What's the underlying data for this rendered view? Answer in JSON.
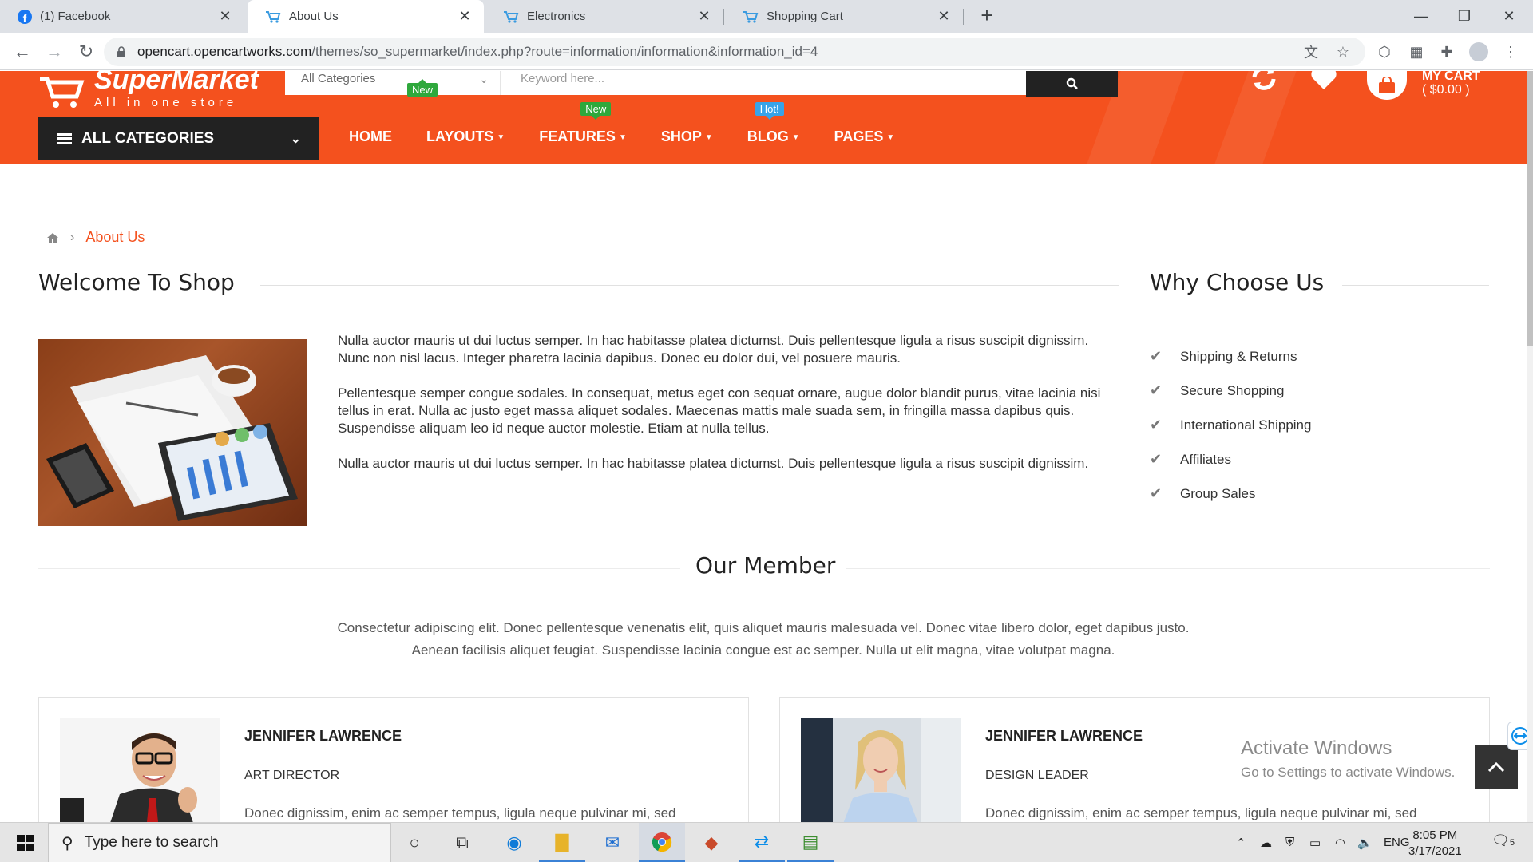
{
  "browser": {
    "tabs": [
      {
        "title": "(1) Facebook",
        "icon": "facebook-icon",
        "active": false
      },
      {
        "title": "About Us",
        "icon": "cart-favicon",
        "active": true
      },
      {
        "title": "Electronics",
        "icon": "cart-favicon",
        "active": false
      },
      {
        "title": "Shopping Cart",
        "icon": "cart-favicon",
        "active": false
      }
    ],
    "url_host": "opencart.opencartworks.com",
    "url_path": "/themes/so_supermarket/index.php?route=information/information&information_id=4"
  },
  "header": {
    "logo_name": "SuperMarket",
    "tagline": "All in one store",
    "category_select": "All Categories",
    "search_placeholder": "Keyword here...",
    "cart_label": "MY CART",
    "cart_total": "( $0.00 )",
    "all_categories_label": "ALL CATEGORIES",
    "nav": [
      {
        "label": "HOME"
      },
      {
        "label": "LAYOUTS"
      },
      {
        "label": "FEATURES"
      },
      {
        "label": "SHOP"
      },
      {
        "label": "BLOG"
      },
      {
        "label": "PAGES"
      }
    ],
    "badges": {
      "features": "New",
      "blog": "Hot!",
      "home": "New"
    },
    "accent_color": "#f4511e"
  },
  "breadcrumb": {
    "current": "About Us"
  },
  "welcome": {
    "heading": "Welcome To Shop",
    "paragraphs": [
      "Nulla auctor mauris ut dui luctus semper. In hac habitasse platea dictumst. Duis pellentesque ligula a risus suscipit dignissim. Nunc non nisl lacus. Integer pharetra lacinia dapibus. Donec eu dolor dui, vel posuere mauris.",
      "Pellentesque semper congue sodales. In consequat, metus eget con sequat ornare, augue dolor blandit purus, vitae lacinia nisi tellus in erat. Nulla ac justo eget massa aliquet sodales. Maecenas mattis male suada sem, in fringilla massa dapibus quis. Suspendisse aliquam leo id neque auctor molestie. Etiam at nulla tellus.",
      "Nulla auctor mauris ut dui luctus semper. In hac habitasse platea dictumst. Duis pellentesque ligula a risus suscipit dignissim."
    ]
  },
  "why": {
    "heading": "Why Choose Us",
    "items": [
      "Shipping & Returns",
      "Secure Shopping",
      "International Shipping",
      "Affiliates",
      "Group Sales"
    ]
  },
  "members": {
    "heading": "Our Member",
    "intro_line1": "Consectetur adipiscing elit. Donec pellentesque venenatis elit, quis aliquet mauris malesuada vel. Donec vitae libero dolor, eget dapibus justo.",
    "intro_line2": "Aenean facilisis aliquet feugiat. Suspendisse lacinia congue est ac semper. Nulla ut elit magna, vitae volutpat magna.",
    "cards": [
      {
        "name": "JENNIFER LAWRENCE",
        "role": "ART DIRECTOR",
        "bio": "Donec dignissim, enim ac semper tempus, ligula neque pulvinar mi, sed"
      },
      {
        "name": "JENNIFER LAWRENCE",
        "role": "DESIGN LEADER",
        "bio": "Donec dignissim, enim ac semper tempus, ligula neque pulvinar mi, sed"
      }
    ]
  },
  "watermark": {
    "line1": "Activate Windows",
    "line2": "Go to Settings to activate Windows."
  },
  "taskbar": {
    "search_placeholder": "Type here to search",
    "language": "ENG",
    "time": "8:05 PM",
    "date": "3/17/2021",
    "notification_count": "5"
  }
}
